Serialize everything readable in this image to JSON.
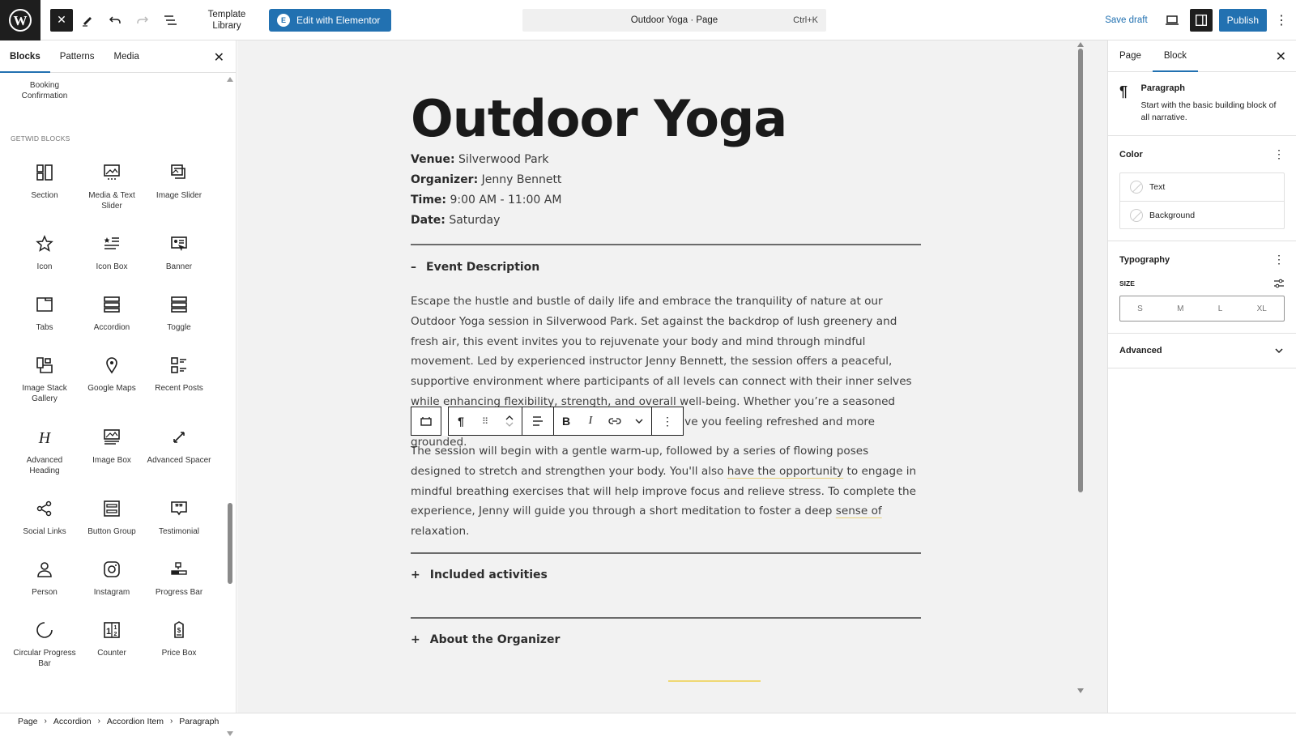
{
  "topbar": {
    "template_library": "Template Library",
    "edit_elementor": "Edit with Elementor",
    "command": "Outdoor Yoga · Page",
    "shortcut": "Ctrl+K",
    "save_draft": "Save draft",
    "publish": "Publish"
  },
  "inserter": {
    "tabs": [
      "Blocks",
      "Patterns",
      "Media"
    ],
    "booking": "Booking Confirmation",
    "category": "GETWID BLOCKS",
    "blocks": [
      {
        "label": "Section",
        "icon": "section-icon"
      },
      {
        "label": "Media & Text Slider",
        "icon": "media-text-slider-icon"
      },
      {
        "label": "Image Slider",
        "icon": "image-slider-icon"
      },
      {
        "label": "Icon",
        "icon": "star-icon"
      },
      {
        "label": "Icon Box",
        "icon": "icon-box-icon"
      },
      {
        "label": "Banner",
        "icon": "banner-icon"
      },
      {
        "label": "Tabs",
        "icon": "tabs-icon"
      },
      {
        "label": "Accordion",
        "icon": "accordion-icon"
      },
      {
        "label": "Toggle",
        "icon": "toggle-icon"
      },
      {
        "label": "Image Stack Gallery",
        "icon": "image-stack-icon"
      },
      {
        "label": "Google Maps",
        "icon": "map-pin-icon"
      },
      {
        "label": "Recent Posts",
        "icon": "recent-posts-icon"
      },
      {
        "label": "Advanced Heading",
        "icon": "heading-icon"
      },
      {
        "label": "Image Box",
        "icon": "image-box-icon"
      },
      {
        "label": "Advanced Spacer",
        "icon": "spacer-icon"
      },
      {
        "label": "Social Links",
        "icon": "share-icon"
      },
      {
        "label": "Button Group",
        "icon": "button-group-icon"
      },
      {
        "label": "Testimonial",
        "icon": "testimonial-icon"
      },
      {
        "label": "Person",
        "icon": "person-icon"
      },
      {
        "label": "Instagram",
        "icon": "instagram-icon"
      },
      {
        "label": "Progress Bar",
        "icon": "progress-bar-icon"
      },
      {
        "label": "Circular Progress Bar",
        "icon": "circular-progress-icon"
      },
      {
        "label": "Counter",
        "icon": "counter-icon"
      },
      {
        "label": "Price Box",
        "icon": "price-box-icon"
      }
    ]
  },
  "page": {
    "title": "Outdoor Yoga",
    "meta": [
      {
        "label": "Venue:",
        "value": "Silverwood Park"
      },
      {
        "label": "Organizer:",
        "value": "Jenny Bennett"
      },
      {
        "label": "Time:",
        "value": "9:00 AM - 11:00 AM"
      },
      {
        "label": "Date:",
        "value": "Saturday"
      }
    ],
    "accordion": [
      {
        "title": "Event Description",
        "expanded": true
      },
      {
        "title": "Included activities",
        "expanded": false
      },
      {
        "title": "About the Organizer",
        "expanded": false
      }
    ],
    "para1": "Escape the hustle and bustle of daily life and embrace the tranquility of nature at our Outdoor Yoga session in Silverwood Park. Set against the backdrop of lush greenery and fresh air, this event invites you to rejuvenate your body and mind through mindful movement. Led by experienced instructor Jenny Bennett, the session offers a peaceful, supportive environment where participants of all levels can connect with their inner selves while enhancing flexibility, strength, and overall well-being. Whether you’re a seasoned yogi or new to the practice, this workshop will leave you feeling refreshed and more grounded.",
    "para2_a": "The session will begin with a gentle warm-up, followed by a series of flowing poses designed to stretch and strengthen your body. You'll also ",
    "para2_b": "have the opportunity",
    "para2_c": " to engage in mindful breathing exercises that will help improve focus and relieve stress. To complete the experience, Jenny will guide you through a short meditation to foster a deep ",
    "para2_d": "sense of",
    "para2_e": " relaxation."
  },
  "sidebar": {
    "tabs": [
      "Page",
      "Block"
    ],
    "block_name": "Paragraph",
    "block_desc": "Start with the basic building block of all narrative.",
    "color_title": "Color",
    "color_text": "Text",
    "color_bg": "Background",
    "typography": "Typography",
    "size_label": "SIZE",
    "sizes": [
      "S",
      "M",
      "L",
      "XL"
    ],
    "advanced": "Advanced"
  },
  "breadcrumb": [
    "Page",
    "Accordion",
    "Accordion Item",
    "Paragraph"
  ],
  "colors": {
    "accent": "#2271b1",
    "dark": "#1e1e1e",
    "canvas": "#f2f2f2",
    "highlight": "#efd873"
  }
}
